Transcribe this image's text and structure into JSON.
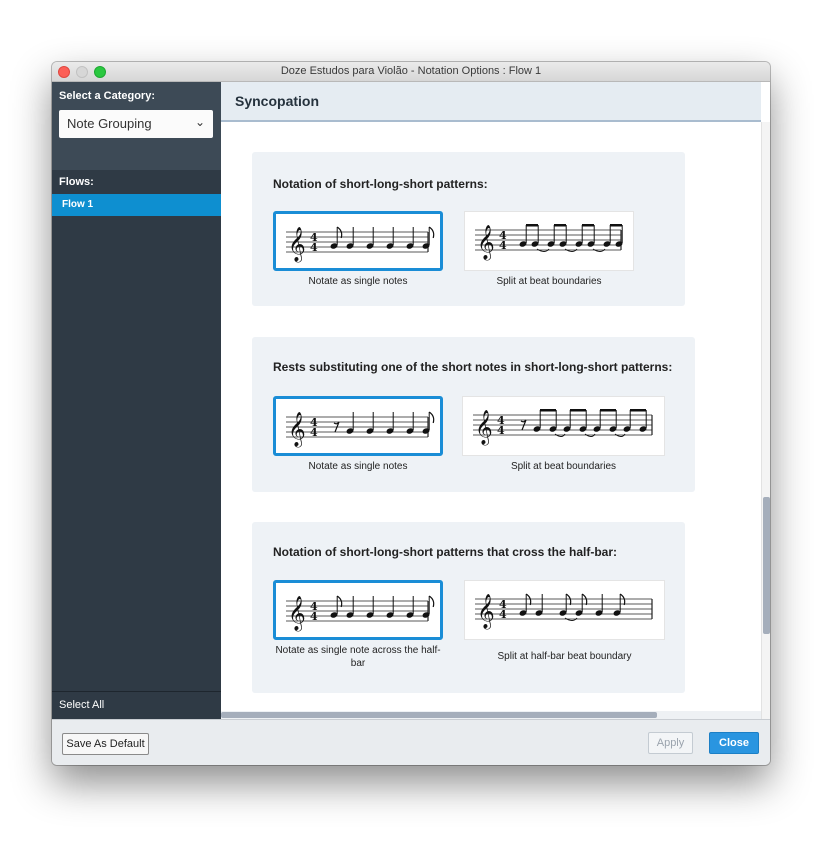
{
  "window": {
    "title": "Doze Estudos para Violão - Notation Options : Flow 1"
  },
  "sidebar": {
    "category_label": "Select a Category:",
    "category_value": "Note Grouping",
    "flows_label": "Flows:",
    "flows": [
      "Flow 1"
    ],
    "select_all": "Select All"
  },
  "section": {
    "title": "Syncopation"
  },
  "panels": [
    {
      "title": "Notation of short-long-short patterns:",
      "options": [
        {
          "label": "Notate as single notes",
          "selected": true
        },
        {
          "label": "Split at beat boundaries",
          "selected": false
        }
      ]
    },
    {
      "title": "Rests substituting one of the short notes in short-long-short patterns:",
      "options": [
        {
          "label": "Notate as single notes",
          "selected": true
        },
        {
          "label": "Split at beat boundaries",
          "selected": false
        }
      ]
    },
    {
      "title": "Notation of short-long-short patterns that cross the half-bar:",
      "options": [
        {
          "label": "Notate as single note across the half-bar",
          "selected": true
        },
        {
          "label": "Split at half-bar beat boundary",
          "selected": false
        }
      ]
    }
  ],
  "footer": {
    "save_default": "Save As Default",
    "apply": "Apply",
    "close": "Close"
  },
  "colors": {
    "accent": "#1a8dd6",
    "sidebar": "#2f3a45",
    "selected_flow": "#0e8fd0"
  }
}
